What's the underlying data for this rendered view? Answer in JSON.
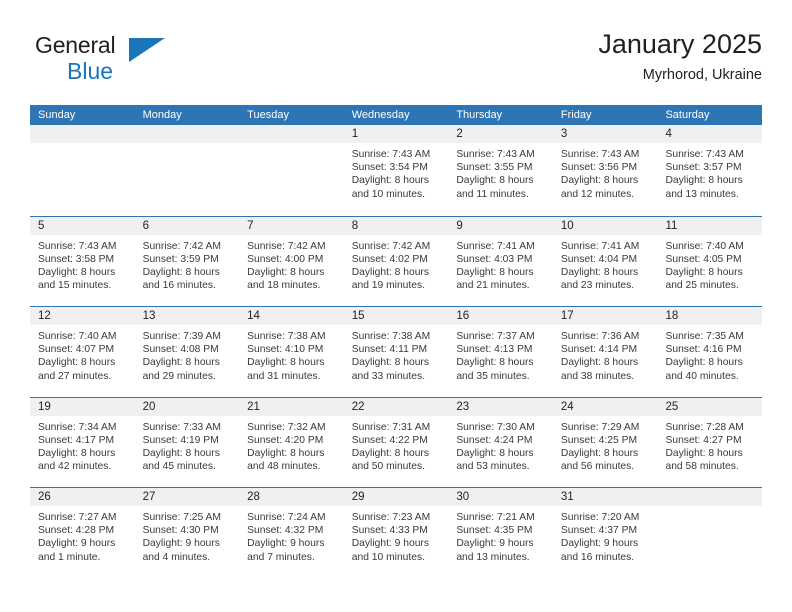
{
  "brand": {
    "name_top": "General",
    "name_bottom": "Blue",
    "accent_color": "#1b75bb",
    "triangle_icon": "triangle-icon"
  },
  "header": {
    "title": "January 2025",
    "location": "Myrhorod, Ukraine"
  },
  "calendar": {
    "header_bg": "#2e75b6",
    "daynum_bg": "#f0f0f0",
    "weekdays": [
      "Sunday",
      "Monday",
      "Tuesday",
      "Wednesday",
      "Thursday",
      "Friday",
      "Saturday"
    ],
    "weeks": [
      [
        {
          "day": "",
          "sunrise": "",
          "sunset": "",
          "daylight1": "",
          "daylight2": ""
        },
        {
          "day": "",
          "sunrise": "",
          "sunset": "",
          "daylight1": "",
          "daylight2": ""
        },
        {
          "day": "",
          "sunrise": "",
          "sunset": "",
          "daylight1": "",
          "daylight2": ""
        },
        {
          "day": "1",
          "sunrise": "Sunrise: 7:43 AM",
          "sunset": "Sunset: 3:54 PM",
          "daylight1": "Daylight: 8 hours",
          "daylight2": "and 10 minutes."
        },
        {
          "day": "2",
          "sunrise": "Sunrise: 7:43 AM",
          "sunset": "Sunset: 3:55 PM",
          "daylight1": "Daylight: 8 hours",
          "daylight2": "and 11 minutes."
        },
        {
          "day": "3",
          "sunrise": "Sunrise: 7:43 AM",
          "sunset": "Sunset: 3:56 PM",
          "daylight1": "Daylight: 8 hours",
          "daylight2": "and 12 minutes."
        },
        {
          "day": "4",
          "sunrise": "Sunrise: 7:43 AM",
          "sunset": "Sunset: 3:57 PM",
          "daylight1": "Daylight: 8 hours",
          "daylight2": "and 13 minutes."
        }
      ],
      [
        {
          "day": "5",
          "sunrise": "Sunrise: 7:43 AM",
          "sunset": "Sunset: 3:58 PM",
          "daylight1": "Daylight: 8 hours",
          "daylight2": "and 15 minutes."
        },
        {
          "day": "6",
          "sunrise": "Sunrise: 7:42 AM",
          "sunset": "Sunset: 3:59 PM",
          "daylight1": "Daylight: 8 hours",
          "daylight2": "and 16 minutes."
        },
        {
          "day": "7",
          "sunrise": "Sunrise: 7:42 AM",
          "sunset": "Sunset: 4:00 PM",
          "daylight1": "Daylight: 8 hours",
          "daylight2": "and 18 minutes."
        },
        {
          "day": "8",
          "sunrise": "Sunrise: 7:42 AM",
          "sunset": "Sunset: 4:02 PM",
          "daylight1": "Daylight: 8 hours",
          "daylight2": "and 19 minutes."
        },
        {
          "day": "9",
          "sunrise": "Sunrise: 7:41 AM",
          "sunset": "Sunset: 4:03 PM",
          "daylight1": "Daylight: 8 hours",
          "daylight2": "and 21 minutes."
        },
        {
          "day": "10",
          "sunrise": "Sunrise: 7:41 AM",
          "sunset": "Sunset: 4:04 PM",
          "daylight1": "Daylight: 8 hours",
          "daylight2": "and 23 minutes."
        },
        {
          "day": "11",
          "sunrise": "Sunrise: 7:40 AM",
          "sunset": "Sunset: 4:05 PM",
          "daylight1": "Daylight: 8 hours",
          "daylight2": "and 25 minutes."
        }
      ],
      [
        {
          "day": "12",
          "sunrise": "Sunrise: 7:40 AM",
          "sunset": "Sunset: 4:07 PM",
          "daylight1": "Daylight: 8 hours",
          "daylight2": "and 27 minutes."
        },
        {
          "day": "13",
          "sunrise": "Sunrise: 7:39 AM",
          "sunset": "Sunset: 4:08 PM",
          "daylight1": "Daylight: 8 hours",
          "daylight2": "and 29 minutes."
        },
        {
          "day": "14",
          "sunrise": "Sunrise: 7:38 AM",
          "sunset": "Sunset: 4:10 PM",
          "daylight1": "Daylight: 8 hours",
          "daylight2": "and 31 minutes."
        },
        {
          "day": "15",
          "sunrise": "Sunrise: 7:38 AM",
          "sunset": "Sunset: 4:11 PM",
          "daylight1": "Daylight: 8 hours",
          "daylight2": "and 33 minutes."
        },
        {
          "day": "16",
          "sunrise": "Sunrise: 7:37 AM",
          "sunset": "Sunset: 4:13 PM",
          "daylight1": "Daylight: 8 hours",
          "daylight2": "and 35 minutes."
        },
        {
          "day": "17",
          "sunrise": "Sunrise: 7:36 AM",
          "sunset": "Sunset: 4:14 PM",
          "daylight1": "Daylight: 8 hours",
          "daylight2": "and 38 minutes."
        },
        {
          "day": "18",
          "sunrise": "Sunrise: 7:35 AM",
          "sunset": "Sunset: 4:16 PM",
          "daylight1": "Daylight: 8 hours",
          "daylight2": "and 40 minutes."
        }
      ],
      [
        {
          "day": "19",
          "sunrise": "Sunrise: 7:34 AM",
          "sunset": "Sunset: 4:17 PM",
          "daylight1": "Daylight: 8 hours",
          "daylight2": "and 42 minutes."
        },
        {
          "day": "20",
          "sunrise": "Sunrise: 7:33 AM",
          "sunset": "Sunset: 4:19 PM",
          "daylight1": "Daylight: 8 hours",
          "daylight2": "and 45 minutes."
        },
        {
          "day": "21",
          "sunrise": "Sunrise: 7:32 AM",
          "sunset": "Sunset: 4:20 PM",
          "daylight1": "Daylight: 8 hours",
          "daylight2": "and 48 minutes."
        },
        {
          "day": "22",
          "sunrise": "Sunrise: 7:31 AM",
          "sunset": "Sunset: 4:22 PM",
          "daylight1": "Daylight: 8 hours",
          "daylight2": "and 50 minutes."
        },
        {
          "day": "23",
          "sunrise": "Sunrise: 7:30 AM",
          "sunset": "Sunset: 4:24 PM",
          "daylight1": "Daylight: 8 hours",
          "daylight2": "and 53 minutes."
        },
        {
          "day": "24",
          "sunrise": "Sunrise: 7:29 AM",
          "sunset": "Sunset: 4:25 PM",
          "daylight1": "Daylight: 8 hours",
          "daylight2": "and 56 minutes."
        },
        {
          "day": "25",
          "sunrise": "Sunrise: 7:28 AM",
          "sunset": "Sunset: 4:27 PM",
          "daylight1": "Daylight: 8 hours",
          "daylight2": "and 58 minutes."
        }
      ],
      [
        {
          "day": "26",
          "sunrise": "Sunrise: 7:27 AM",
          "sunset": "Sunset: 4:28 PM",
          "daylight1": "Daylight: 9 hours",
          "daylight2": "and 1 minute."
        },
        {
          "day": "27",
          "sunrise": "Sunrise: 7:25 AM",
          "sunset": "Sunset: 4:30 PM",
          "daylight1": "Daylight: 9 hours",
          "daylight2": "and 4 minutes."
        },
        {
          "day": "28",
          "sunrise": "Sunrise: 7:24 AM",
          "sunset": "Sunset: 4:32 PM",
          "daylight1": "Daylight: 9 hours",
          "daylight2": "and 7 minutes."
        },
        {
          "day": "29",
          "sunrise": "Sunrise: 7:23 AM",
          "sunset": "Sunset: 4:33 PM",
          "daylight1": "Daylight: 9 hours",
          "daylight2": "and 10 minutes."
        },
        {
          "day": "30",
          "sunrise": "Sunrise: 7:21 AM",
          "sunset": "Sunset: 4:35 PM",
          "daylight1": "Daylight: 9 hours",
          "daylight2": "and 13 minutes."
        },
        {
          "day": "31",
          "sunrise": "Sunrise: 7:20 AM",
          "sunset": "Sunset: 4:37 PM",
          "daylight1": "Daylight: 9 hours",
          "daylight2": "and 16 minutes."
        },
        {
          "day": "",
          "sunrise": "",
          "sunset": "",
          "daylight1": "",
          "daylight2": ""
        }
      ]
    ]
  }
}
